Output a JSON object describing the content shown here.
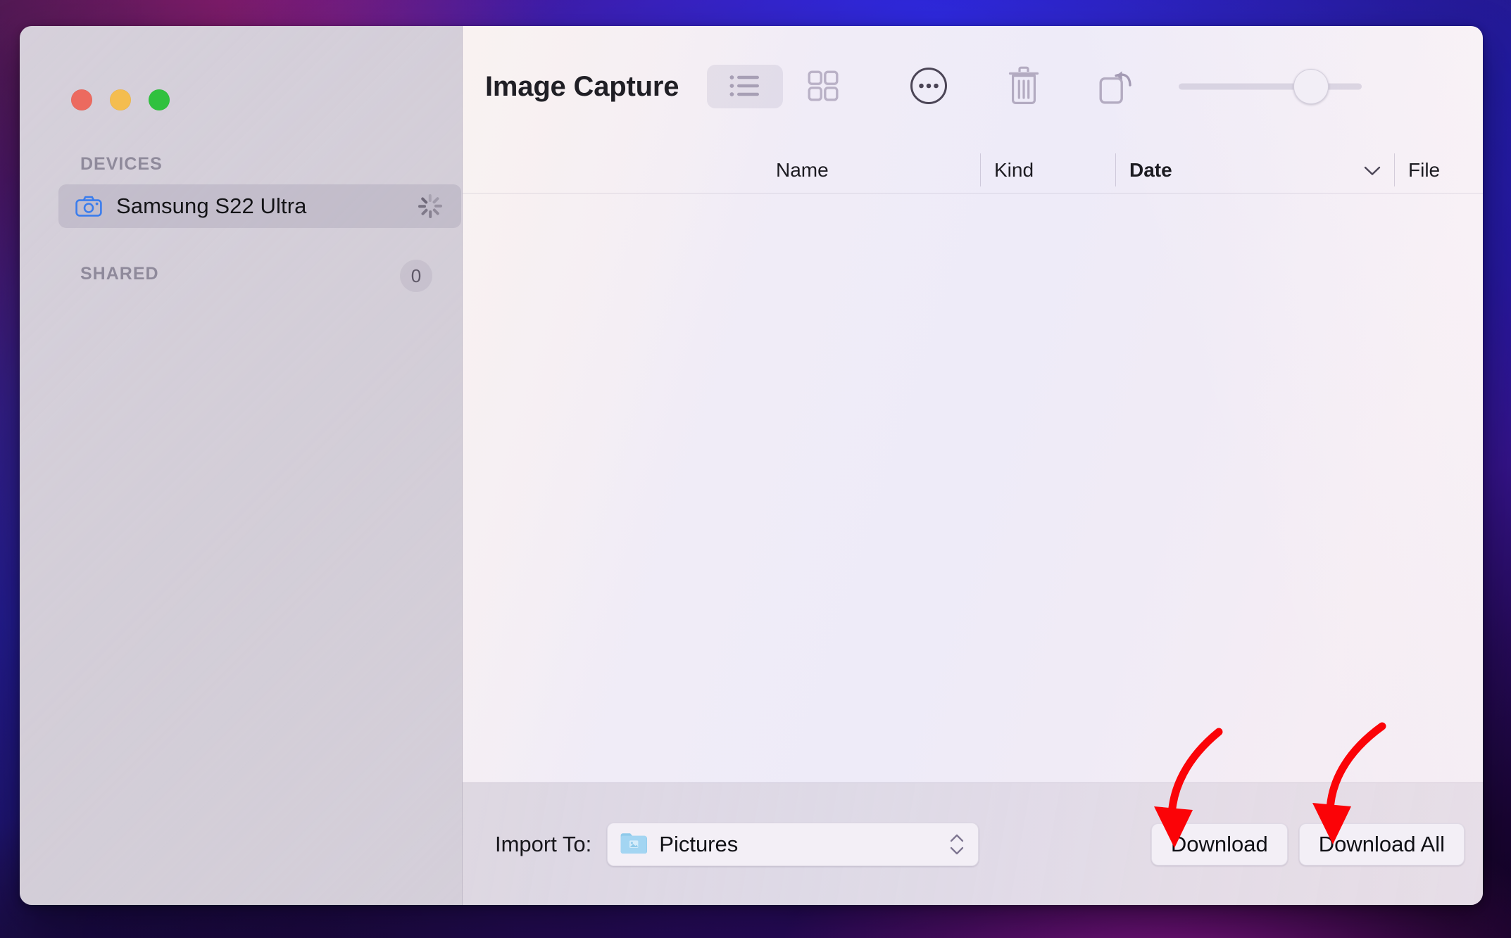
{
  "window": {
    "app_title": "Image Capture",
    "traffic_lights": [
      {
        "name": "close",
        "color": "#ec6a5f"
      },
      {
        "name": "minimize",
        "color": "#f4bd4f"
      },
      {
        "name": "maximize",
        "color": "#30c13e"
      }
    ]
  },
  "sidebar": {
    "sections": [
      {
        "header": "DEVICES",
        "badge": null,
        "items": [
          {
            "label": "Samsung S22 Ultra",
            "icon": "camera-icon",
            "selected": true,
            "busy": true
          }
        ]
      },
      {
        "header": "SHARED",
        "badge": "0",
        "items": []
      }
    ]
  },
  "toolbar": {
    "view_buttons": [
      {
        "name": "list-view",
        "icon": "list-view-icon",
        "selected": true
      },
      {
        "name": "grid-view",
        "icon": "grid-view-icon",
        "selected": false
      }
    ],
    "actions": [
      {
        "name": "more",
        "icon": "more-ellipsis-icon"
      },
      {
        "name": "delete",
        "icon": "trash-icon"
      },
      {
        "name": "rotate",
        "icon": "rotate-left-icon"
      }
    ],
    "zoom_slider": {
      "name": "thumbnail-size-slider",
      "value_percent": 80
    }
  },
  "columns": [
    {
      "key": "name",
      "label": "Name",
      "sorted": false
    },
    {
      "key": "kind",
      "label": "Kind",
      "sorted": false
    },
    {
      "key": "date",
      "label": "Date",
      "sorted": true,
      "sort_caret": "chevron-down-icon"
    },
    {
      "key": "file",
      "label": "File",
      "sorted": false
    }
  ],
  "rows": [],
  "bottom_bar": {
    "import_to_label": "Import To:",
    "import_to_value": "Pictures",
    "import_to_icon": "pictures-folder-icon",
    "stepper_icon": "up-down-chevrons-icon",
    "buttons": [
      {
        "name": "download",
        "label": "Download"
      },
      {
        "name": "download-all",
        "label": "Download All"
      }
    ]
  },
  "annotations": {
    "color": "#fb0307",
    "arrows": [
      {
        "name": "arrow-to-download",
        "target": "download-button"
      },
      {
        "name": "arrow-to-download-all",
        "target": "download-all-button"
      }
    ]
  },
  "colors": {
    "accent_blue": "#3b7ded",
    "annotation_red": "#fb0307",
    "sidebar_bg": "#d5d0d9",
    "content_bg": "#f0ecf6"
  }
}
